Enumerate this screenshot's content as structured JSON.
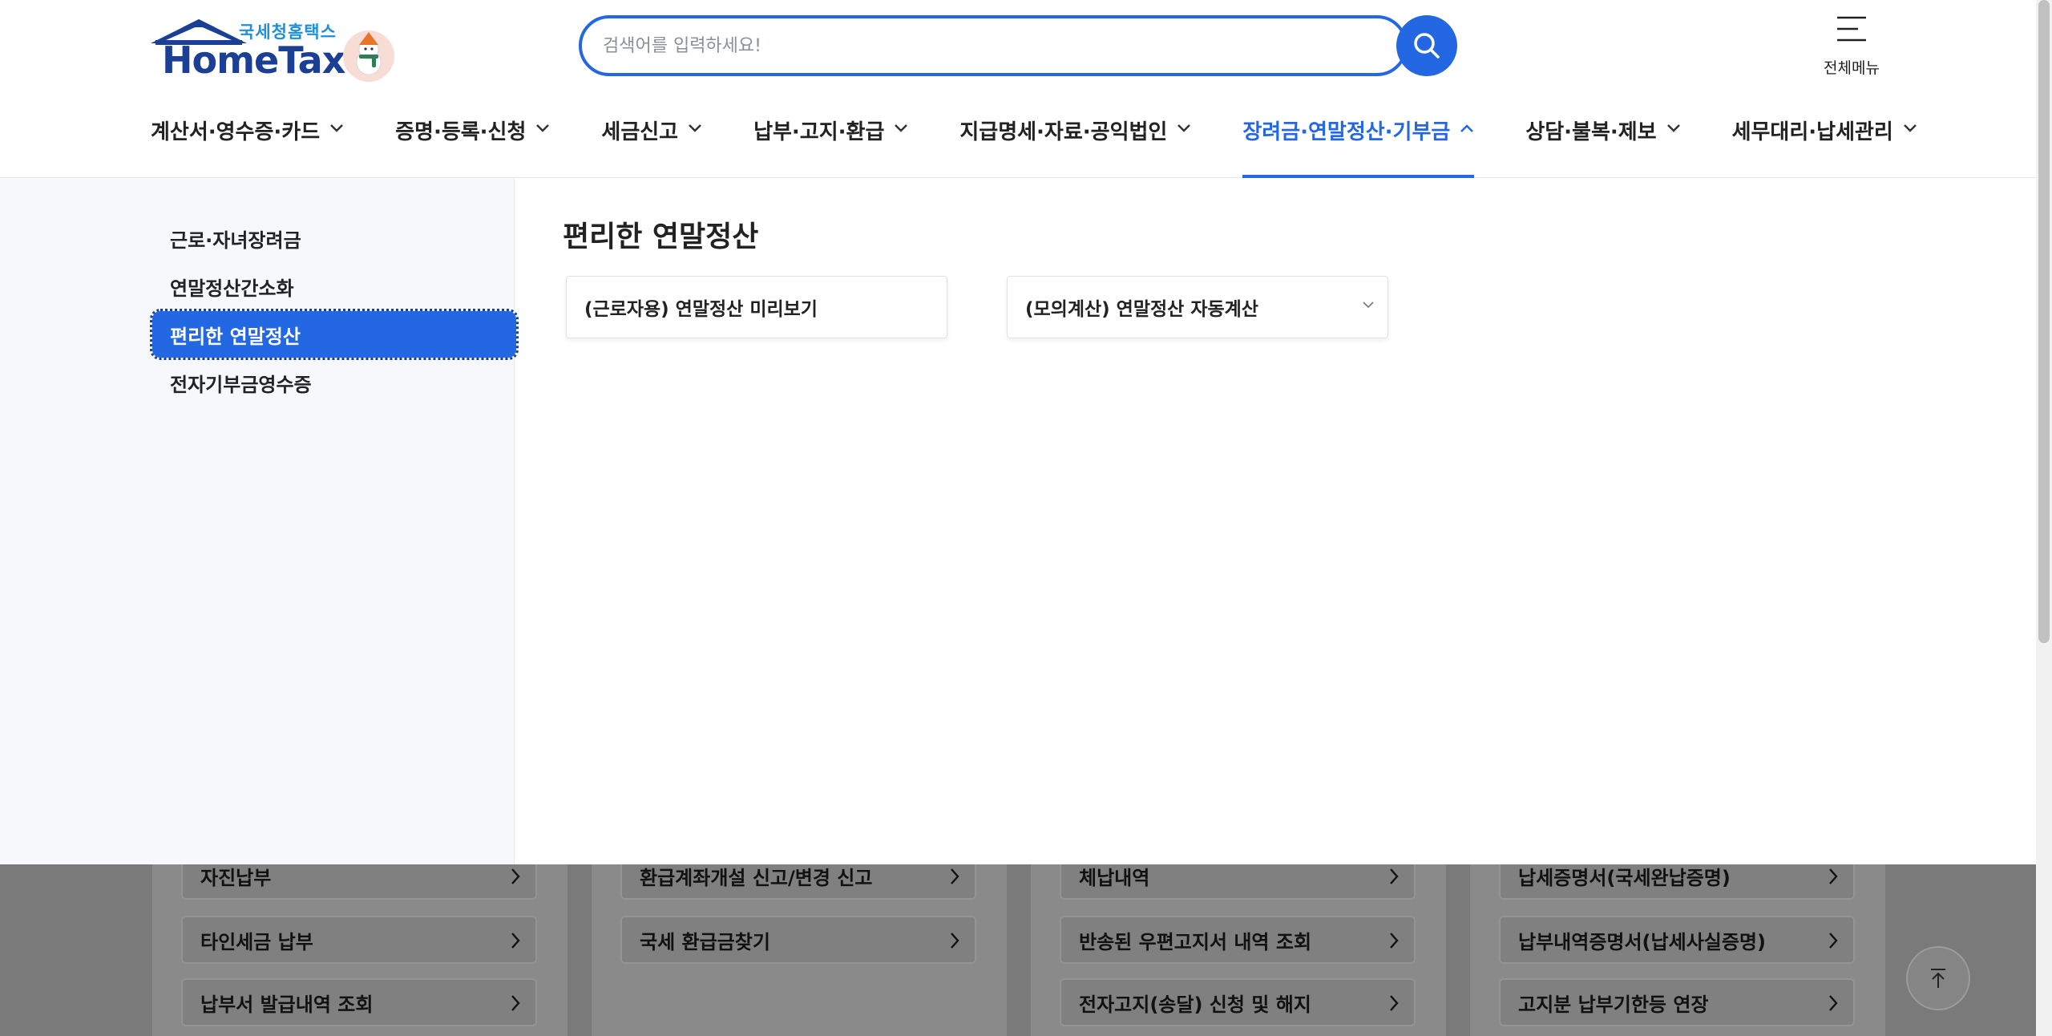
{
  "header": {
    "logo_sub": "국세청홈택스",
    "logo_main": "HomeTax",
    "search_placeholder": "검색어를 입력하세요!",
    "all_menu_label": "전체메뉴"
  },
  "gnb": {
    "items": [
      {
        "label": "계산서·영수증·카드"
      },
      {
        "label": "증명·등록·신청"
      },
      {
        "label": "세금신고"
      },
      {
        "label": "납부·고지·환급"
      },
      {
        "label": "지급명세·자료·공익법인"
      },
      {
        "label": "장려금·연말정산·기부금"
      },
      {
        "label": "상담·불복·제보"
      },
      {
        "label": "세무대리·납세관리"
      }
    ],
    "active_index": 5
  },
  "lnb": {
    "items": [
      {
        "label": "근로·자녀장려금"
      },
      {
        "label": "연말정산간소화"
      },
      {
        "label": "편리한 연말정산"
      },
      {
        "label": "전자기부금영수증"
      }
    ],
    "selected_index": 2
  },
  "content": {
    "title": "편리한 연말정산",
    "cards": [
      {
        "label": "(근로자용) 연말정산 미리보기",
        "has_dropdown": false
      },
      {
        "label": "(모의계산) 연말정산 자동계산",
        "has_dropdown": true
      }
    ]
  },
  "background_page": {
    "columns": [
      {
        "items": [
          {
            "label": "자진납부"
          },
          {
            "label": "타인세금 납부"
          },
          {
            "label": "납부서 발급내역 조회"
          }
        ]
      },
      {
        "items": [
          {
            "label": "환급계좌개설 신고/변경 신고"
          },
          {
            "label": "국세 환급금찾기"
          }
        ]
      },
      {
        "items": [
          {
            "label": "체납내역"
          },
          {
            "label": "반송된 우편고지서 내역 조회"
          },
          {
            "label": "전자고지(송달) 신청 및 해지"
          }
        ]
      },
      {
        "items": [
          {
            "label": "납세증명서(국세완납증명)"
          },
          {
            "label": "납부내역증명서(납세사실증명)"
          },
          {
            "label": "고지분 납부기한등 연장"
          }
        ]
      }
    ]
  },
  "colors": {
    "primary": "#2367e3",
    "logo_blue": "#1b3f94",
    "logo_sub": "#1f8fd6",
    "lnb_bg": "#f6f8fc"
  }
}
